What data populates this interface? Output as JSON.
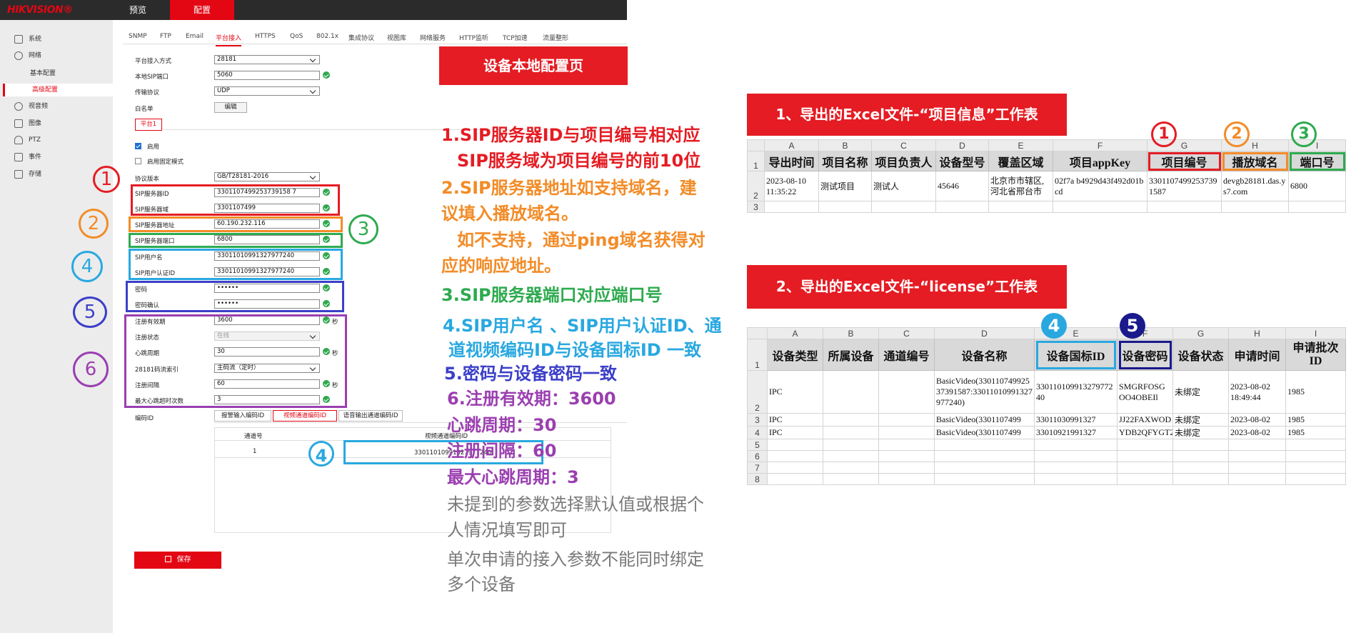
{
  "app": {
    "logo": "HIKVISION®",
    "top_nav": [
      "预览",
      "配置"
    ]
  },
  "sidebar": {
    "items": [
      "系统",
      "网络",
      "视音频",
      "图像",
      "PTZ",
      "事件",
      "存储"
    ],
    "network_sub": [
      "基本配置",
      "高级配置"
    ]
  },
  "tabs": [
    "SNMP",
    "FTP",
    "Email",
    "平台接入",
    "HTTPS",
    "QoS",
    "802.1x",
    "集成协议",
    "视图库",
    "网络服务",
    "HTTP监听",
    "TCP加速",
    "流量整形"
  ],
  "form": {
    "platform_access_mode_label": "平台接入方式",
    "platform_access_mode": "28181",
    "local_sip_port_label": "本地SIP端口",
    "local_sip_port": "5060",
    "transport_label": "传输协议",
    "transport": "UDP",
    "whitelist_label": "白名单",
    "edit_btn": "编辑",
    "platform_tab": "平台1",
    "enable_label": "启用",
    "fixed_mode_label": "启用固定模式",
    "protocol_label": "协议版本",
    "protocol": "GB/T28181-2016",
    "sip_server_id_label": "SIP服务器ID",
    "sip_server_id": "3301107499253739158 7",
    "sip_domain_label": "SIP服务器域",
    "sip_domain": "3301107499",
    "sip_addr_label": "SIP服务器地址",
    "sip_addr": "60.190.232.116",
    "sip_port_label": "SIP服务器端口",
    "sip_port": "6800",
    "sip_user_label": "SIP用户名",
    "sip_user": "33011010991327977240",
    "sip_auth_label": "SIP用户认证ID",
    "sip_auth": "33011010991327977240",
    "pwd_label": "密码",
    "pwd": "••••••",
    "pwd_confirm_label": "密码确认",
    "pwd_confirm": "••••••",
    "reg_valid_label": "注册有效期",
    "reg_valid": "3600",
    "reg_status_label": "注册状态",
    "reg_status": "在线",
    "heartbeat_label": "心跳周期",
    "heartbeat": "30",
    "stream_index_label": "28181码流索引",
    "stream_index": "主码流（定时）",
    "reg_interval_label": "注册间隔",
    "reg_interval": "60",
    "max_hb_label": "最大心跳超时次数",
    "max_hb": "3",
    "sec_unit": "秒",
    "encode_id_label": "编码ID",
    "subtabs": [
      "报警输入编码ID",
      "视频通道编码ID",
      "语音输出通道编码ID"
    ],
    "table_headers": [
      "通道号",
      "视频通道编码ID"
    ],
    "table_row": [
      "1",
      "33011010991327977240"
    ],
    "save_btn": "保存"
  },
  "notes": {
    "banner": "设备本地配置页",
    "n1a": "1.SIP服务器ID与项目编号相对应",
    "n1b": "SIP服务域为项目编号的前10位",
    "n2a": "2.SIP服务器地址如支持域名，建",
    "n2b": "议填入播放域名。",
    "n2c": "如不支持，通过ping域名获得对",
    "n2d": "应的响应地址。",
    "n3": "3.SIP服务器端口对应端口号",
    "n4a": "4.SIP用户名 、SIP用户认证ID、通",
    "n4b": "道视频编码ID与设备国标ID 一致",
    "n5": "5.密码与设备密码一致",
    "n6a": "6.注册有效期：3600",
    "n6b": "心跳周期：30",
    "n6c": "注册间隔：60",
    "n6d": "最大心跳周期：3",
    "n7a": "未提到的参数选择默认值或根据个",
    "n7b": "人情况填写即可",
    "n8a": "单次申请的接入参数不能同时绑定",
    "n8b": "多个设备"
  },
  "markers": [
    "①",
    "②",
    "③",
    "④",
    "⑤",
    "⑥"
  ],
  "sheet1": {
    "banner": "1、导出的Excel文件-“项目信息”工作表",
    "cols": [
      "A",
      "B",
      "C",
      "D",
      "E",
      "F",
      "G",
      "H",
      "I"
    ],
    "headers": [
      "导出时间",
      "项目名称",
      "项目负责人",
      "设备型号",
      "覆盖区域",
      "项目appKey",
      "项目编号",
      "播放域名",
      "端口号"
    ],
    "row": [
      "2023-08-10 11:35:22",
      "测试项目",
      "测试人",
      "45646",
      "北京市市辖区,河北省邢台市",
      "02f7a        b4929d43f492d01bcd",
      "33011074992537391587",
      "devgb28181.das.ys7.com",
      "6800"
    ]
  },
  "sheet2": {
    "banner": "2、导出的Excel文件-“license”工作表",
    "cols": [
      "A",
      "B",
      "C",
      "D",
      "E",
      "F",
      "G",
      "H",
      "I"
    ],
    "headers": [
      "设备类型",
      "所属设备",
      "通道编号",
      "设备名称",
      "设备国标ID",
      "设备密码",
      "设备状态",
      "申请时间",
      "申请批次ID"
    ],
    "rows": [
      [
        "IPC",
        "",
        "",
        "BasicVideo(33011074992537391587:33011010991327977240)",
        "33011010991327977240",
        "SMGRFOSGOO4OBEIl",
        "未绑定",
        "2023-08-02 18:49:44",
        "1985"
      ],
      [
        "IPC",
        "",
        "",
        "BasicVideo(3301107499",
        "33011030991327",
        "JJ22FAXWOD",
        "未绑定",
        "2023-08-02",
        "1985"
      ],
      [
        "IPC",
        "",
        "",
        "BasicVideo(3301107499",
        "33010921991327",
        "YDB2QFYGT2",
        "未绑定",
        "2023-08-02",
        "1985"
      ]
    ]
  }
}
